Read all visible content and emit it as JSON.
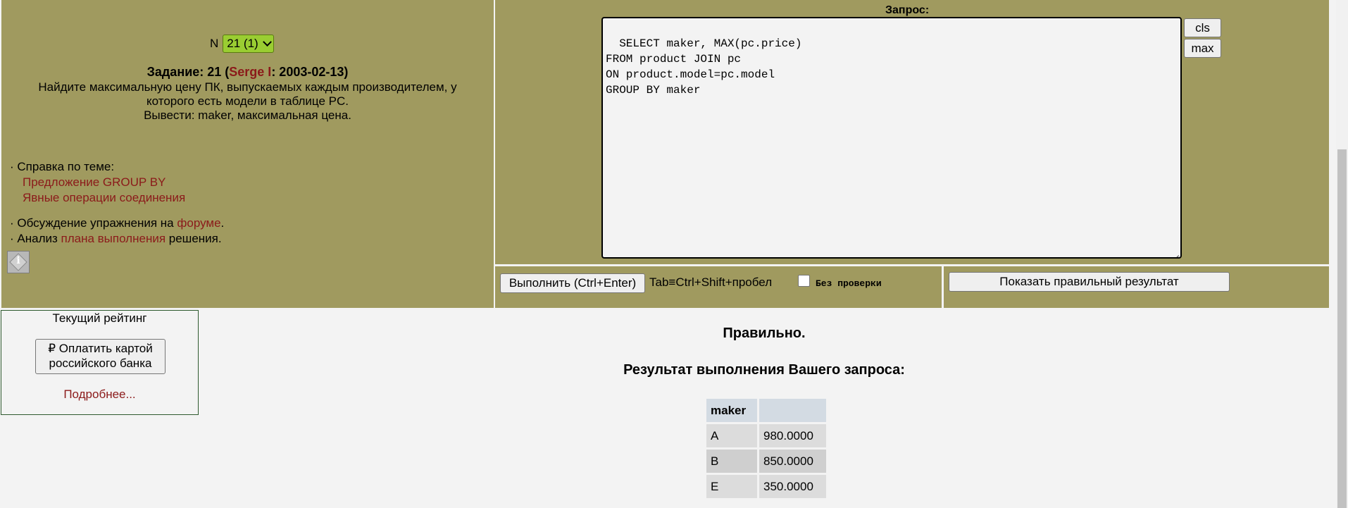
{
  "task_nav": {
    "prefix": "N",
    "selected": "21 (1)"
  },
  "task": {
    "title_prefix": "Задание: 21 (",
    "author": "Serge I",
    "title_suffix": ": 2003-02-13)",
    "text_line1": "Найдите максимальную цену ПК, выпускаемых каждым производителем, у",
    "text_line2": "которого есть модели в таблице PC.",
    "text_line3": "Вывести: maker, максимальная цена."
  },
  "help": {
    "topic_label": "· Справка по теме:",
    "links": [
      "Предложение GROUP BY",
      "Явные операции соединения"
    ],
    "forum_prefix": "· Обсуждение упражнения на ",
    "forum_link": "форуме",
    "forum_suffix": ".",
    "plan_prefix": "· Анализ ",
    "plan_link": "плана выполнения",
    "plan_suffix": " решения."
  },
  "query": {
    "label": "Запрос:",
    "text": "SELECT maker, MAX(pc.price)\nFROM product JOIN pc\nON product.model=pc.model\nGROUP BY maker",
    "cls_label": "cls",
    "max_label": "max"
  },
  "actions": {
    "run_label": "Выполнить (Ctrl+Enter)",
    "tab_hint": "Tab≡Ctrl+Shift+пробел",
    "no_check_label": "Без проверки",
    "show_result_label": "Показать правильный результат"
  },
  "rating": {
    "title": "Текущий рейтинг",
    "pay_label_line1": "₽ Оплатить картой",
    "pay_label_line2": "российского банка",
    "more_label": "Подробнее..."
  },
  "result": {
    "status": "Правильно.",
    "title": "Результат выполнения Вашего запроса:",
    "columns": [
      "maker",
      ""
    ],
    "rows": [
      [
        "A",
        "980.0000"
      ],
      [
        "B",
        "850.0000"
      ],
      [
        "E",
        "350.0000"
      ]
    ]
  }
}
